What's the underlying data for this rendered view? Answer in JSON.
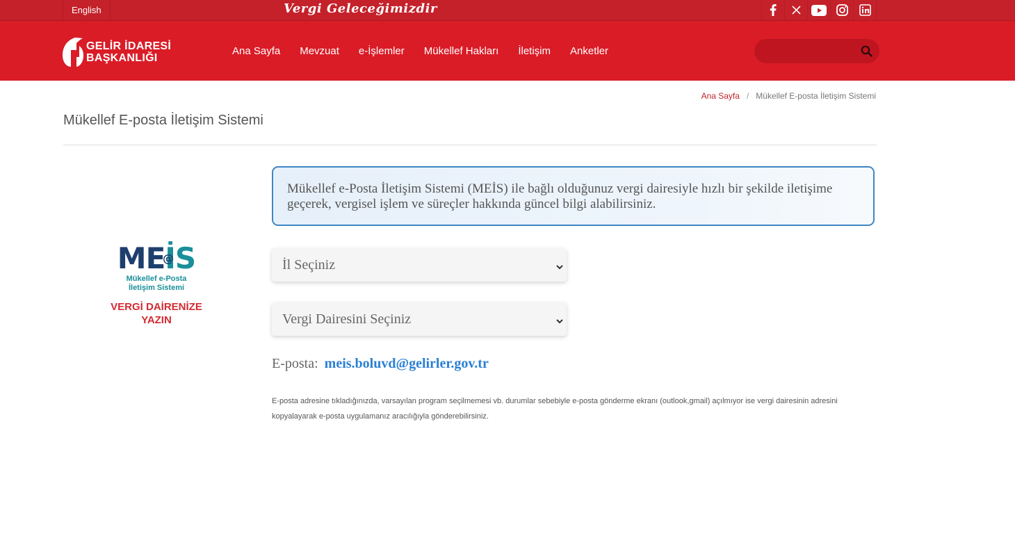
{
  "topbar": {
    "language_link": "English",
    "slogan": "Vergi Geleceğimizdir",
    "social": [
      {
        "icon": "facebook-icon"
      },
      {
        "icon": "x-twitter-icon"
      },
      {
        "icon": "youtube-icon"
      },
      {
        "icon": "instagram-icon"
      },
      {
        "icon": "linkedin-icon"
      }
    ]
  },
  "header": {
    "logo_line1": "GELİR İDARESİ",
    "logo_line2": "BAŞKANLIĞI",
    "nav": [
      "Ana Sayfa",
      "Mevzuat",
      "e-İşlemler",
      "Mükellef Hakları",
      "İletişim",
      "Anketler"
    ],
    "search_placeholder": "",
    "colors": {
      "brand": "#da1c27",
      "topbar": "#c4212b",
      "search": "#bf1520"
    }
  },
  "breadcrumb": {
    "home": "Ana Sayfa",
    "separator": "/",
    "current": "Mükellef E-posta İletişim Sistemi"
  },
  "page": {
    "title": "Mükellef E-posta İletişim Sistemi",
    "meis_logo": {
      "word": "ME",
      "word_accent": "İS",
      "at_sign": "@",
      "sub_line1": "Mükellef e-Posta",
      "sub_line2": "İletişim Sistemi",
      "slogan_line1": "VERGİ DAİRENİZE",
      "slogan_line2": "YAZIN"
    },
    "info_text": "Mükellef e-Posta İletişim Sistemi (MEİS) ile bağlı olduğunuz vergi dairesiyle hızlı bir şekilde iletişime geçerek, vergisel işlem ve süreçler hakkında güncel bilgi alabilirsiniz.",
    "province_select": "İl Seçiniz",
    "office_select": "Vergi Dairesini Seçiniz",
    "email_label": "E-posta:",
    "email_address": "meis.boluvd@gelirler.gov.tr",
    "note": "E-posta adresine tıkladığınızda, varsayılan program seçilmemesi vb. durumlar sebebiyle e-posta gönderme ekranı (outlook,gmail) açılmıyor ise vergi dairesinin adresini kopyalayarak e-posta uygulamanız aracılığıyla gönderebilirsiniz."
  }
}
